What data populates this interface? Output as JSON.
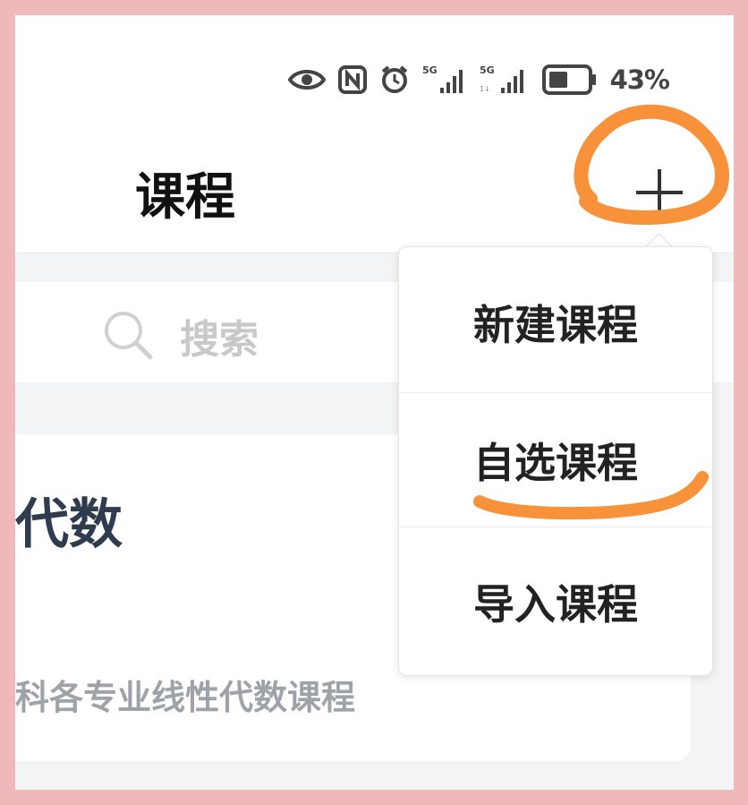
{
  "status_bar": {
    "icons": [
      "eye-icon",
      "nfc-icon",
      "alarm-icon",
      "signal-5g-icon",
      "signal-5g-icon",
      "battery-icon"
    ],
    "network_1": "5G",
    "network_2": "5G",
    "battery_percent": "43%"
  },
  "header": {
    "title": "课程",
    "add_icon": "plus-icon"
  },
  "search": {
    "placeholder": "搜索",
    "icon": "search-icon"
  },
  "course_card": {
    "title": "代数",
    "subtitle": "",
    "description": "科各专业线性代数课程"
  },
  "add_menu": {
    "items": [
      {
        "label": "新建课程"
      },
      {
        "label": "自选课程"
      },
      {
        "label": "导入课程"
      }
    ]
  },
  "colors": {
    "annotation": "#f7923a",
    "frame": "#f0b8b8",
    "course_title": "#2f3b4f"
  }
}
